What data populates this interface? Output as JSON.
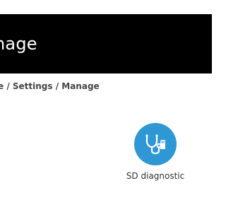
{
  "header": {
    "title": "nage",
    "background": "#000000"
  },
  "breadcrumb": {
    "text": "e / Settings / Manage"
  },
  "tiles": [
    {
      "label": "SD diagnostic",
      "icon": "stethoscope-sd-card-icon",
      "color": "#2f97d3"
    }
  ]
}
